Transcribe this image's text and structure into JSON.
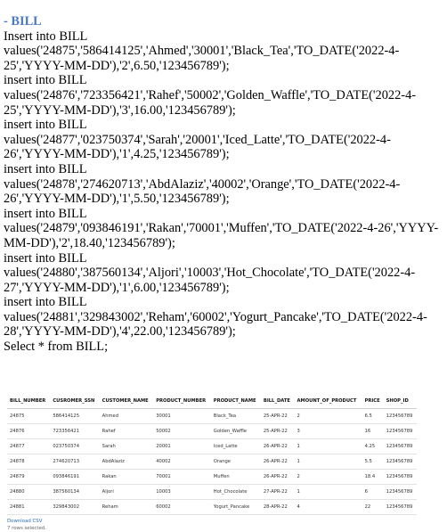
{
  "script": {
    "heading": "- BILL",
    "lines": [
      "Insert into BILL values('24875','586414125','Ahmed','30001','Black_Tea','TO_DATE('2022-4-25','YYYY-MM-DD'),'2',6.50,'123456789');",
      "insert into BILL values('24876','723356421','Rahef','50002','Golden_Waffle','TO_DATE('2022-4-25','YYYY-MM-DD'),'3',16.00,'123456789');",
      "insert into BILL values('24877','023750374','Sarah','20001','Iced_Latte','TO_DATE('2022-4-26','YYYY-MM-DD'),'1',4.25,'123456789');",
      "insert into BILL values('24878','274620713','AbdAlaziz','40002','Orange','TO_DATE('2022-4-26','YYYY-MM-DD'),'1',5.50,'123456789');",
      "insert into BILL values('24879','093846191','Rakan','70001','Muffen','TO_DATE('2022-4-26','YYYY-MM-DD'),'2',18.40,'123456789');",
      "insert into BILL values('24880','387560134','Aljori','10003','Hot_Chocolate','TO_DATE('2022-4-27','YYYY-MM-DD'),'1',6.00,'123456789');",
      "insert into BILL values('24881','329843002','Reham','60002','Yogurt_Pancake','TO_DATE('2022-4-28','YYYY-MM-DD'),'4',22.00,'123456789');",
      "Select * from BILL;"
    ]
  },
  "results": {
    "columns": [
      "BILL_NUMBER",
      "CUSROMER_SSN",
      "CUSTOMER_NAME",
      "PRODUCT_NUMBER",
      "PRODUCT_NAME",
      "BILL_DATE",
      "AMOUNT_OF_PRODUCT",
      "PRICE",
      "SHOP_ID"
    ],
    "rows": [
      [
        "24875",
        "586414125",
        "Ahmed",
        "30001",
        "Black_Tea",
        "25-APR-22",
        "2",
        "6.5",
        "123456789"
      ],
      [
        "24876",
        "723356421",
        "Rahef",
        "50002",
        "Golden_Waffle",
        "25-APR-22",
        "3",
        "16",
        "123456789"
      ],
      [
        "24877",
        "023750374",
        "Sarah",
        "20001",
        "Iced_Latte",
        "26-APR-22",
        "1",
        "4.25",
        "123456789"
      ],
      [
        "24878",
        "274620713",
        "AbdAlaziz",
        "40002",
        "Orange",
        "26-APR-22",
        "1",
        "5.5",
        "123456789"
      ],
      [
        "24879",
        "093846191",
        "Rakan",
        "70001",
        "Muffen",
        "26-APR-22",
        "2",
        "18.4",
        "123456789"
      ],
      [
        "24880",
        "387560134",
        "Aljori",
        "10003",
        "Hot_Chocolate",
        "27-APR-22",
        "1",
        "6",
        "123456789"
      ],
      [
        "24881",
        "329843002",
        "Reham",
        "60002",
        "Yogurt_Pancake",
        "28-APR-22",
        "4",
        "22",
        "123456789"
      ]
    ],
    "download_label": "Download CSV",
    "rows_selected": "7 rows selected."
  }
}
